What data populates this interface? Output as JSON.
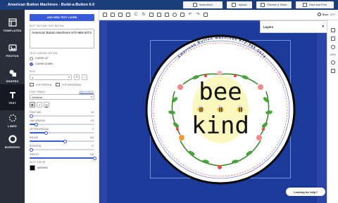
{
  "app": {
    "title": "American Button Machines - Build-a-Button 6.0"
  },
  "top_buttons": {
    "instructions": "Instructions",
    "upload": "Upload",
    "preview": "Preview & Share",
    "save": "Save and Print"
  },
  "sidebar": {
    "items": [
      {
        "label": "TEMPLATES",
        "icon": "templates-icon"
      },
      {
        "label": "PHOTOS",
        "icon": "photos-icon"
      },
      {
        "label": "SHAPES",
        "icon": "shapes-icon"
      },
      {
        "label": "TEXT",
        "icon": "text-icon"
      },
      {
        "label": "LINES",
        "icon": "lines-icon"
      },
      {
        "label": "BORDERS",
        "icon": "borders-icon"
      }
    ]
  },
  "panel": {
    "add_button": "ADD NEW TEXT LAYER",
    "edit_label": "EDIT TAG LINE TEXT BELOW",
    "text_value": "American Button Machines 972-985-5074",
    "curved_label": "TEXT CURVED OPTION",
    "curve_up": "CURVE UP",
    "curve_down": "CURVE DOWN",
    "size_label": "SIZE",
    "size_value": "1",
    "flip_vertical": "FLIP VERTICAL",
    "flip_horizontal": "FLIP HORIZONTAL",
    "font_family_label": "FONT FAMILY",
    "add_fonts": "ADD FONTS",
    "font_value": "Verdana",
    "sliders": [
      {
        "label": "FONT SIZE",
        "value": "10",
        "fraction": 0.0
      },
      {
        "label": "LINE SPACING",
        "value": "0.9",
        "fraction": 0.1
      },
      {
        "label": "LETTER SPACING",
        "value": "3",
        "fraction": 0.25
      },
      {
        "label": "RADIUS",
        "value": "100",
        "fraction": 0.55
      },
      {
        "label": "ROTATION",
        "value": "0°",
        "fraction": 0.0
      },
      {
        "label": "OPACITY",
        "value": "100",
        "fraction": 1.0
      }
    ],
    "text_color_label": "TEXT COLOR",
    "text_color_value": "#000000"
  },
  "toolbar": {
    "size_label": "Size:",
    "size_value": "3.0\""
  },
  "design": {
    "curved_text": "American Button Machines 972-985-5074",
    "word1": "bee",
    "word2": "kind",
    "background_color": "#1b3a99",
    "accent_color": "#3a5ad6"
  },
  "layers": {
    "title": "Layers"
  },
  "right_column": {
    "zoom": "130%"
  },
  "help": {
    "label": "Looking for help?"
  }
}
